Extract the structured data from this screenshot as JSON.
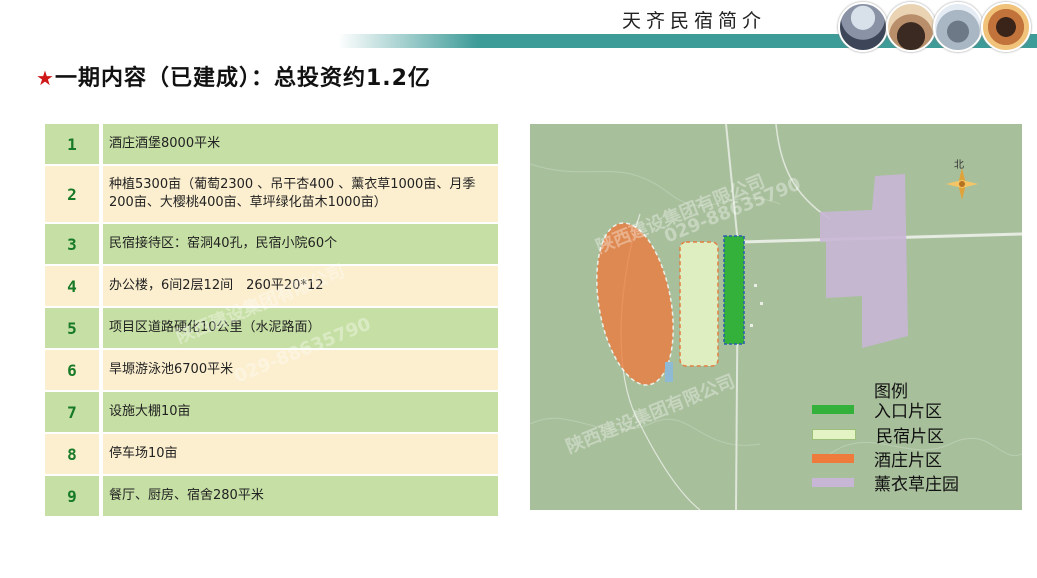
{
  "header": {
    "title": "天齐民宿简介"
  },
  "title": {
    "star": "★",
    "text": "一期内容（已建成）：总投资约1.2亿"
  },
  "table": [
    {
      "num": "1",
      "text": "酒庄酒堡8000平米",
      "style": "green"
    },
    {
      "num": "2",
      "text": "种植5300亩（葡萄2300 、吊干杏400 、薰衣草1000亩、月季200亩、大樱桃400亩、草坪绿化苗木1000亩）",
      "style": "cream"
    },
    {
      "num": "3",
      "text": "民宿接待区：窑洞40孔，民宿小院60个",
      "style": "green"
    },
    {
      "num": "4",
      "text": "办公楼，6间2层12间　260平20*12",
      "style": "cream"
    },
    {
      "num": "5",
      "text": "项目区道路硬化10公里（水泥路面）",
      "style": "green"
    },
    {
      "num": "6",
      "text": "旱塬游泳池6700平米",
      "style": "cream"
    },
    {
      "num": "7",
      "text": "设施大棚10亩",
      "style": "green"
    },
    {
      "num": "8",
      "text": "停车场10亩",
      "style": "cream"
    },
    {
      "num": "9",
      "text": "餐厅、厨房、宿舍280平米",
      "style": "green"
    }
  ],
  "legend": {
    "title": "图例",
    "items": [
      {
        "label": "入口片区",
        "color": "#33b13a"
      },
      {
        "label": "民宿片区",
        "color": "#e3f3c4"
      },
      {
        "label": "酒庄片区",
        "color": "#ee7b3c"
      },
      {
        "label": "薰衣草庄园",
        "color": "#c8b6d6"
      }
    ]
  },
  "map": {
    "north_label": "北"
  },
  "watermark": {
    "company": "陕西建设集团有限公司",
    "phone": "029-88635790"
  }
}
